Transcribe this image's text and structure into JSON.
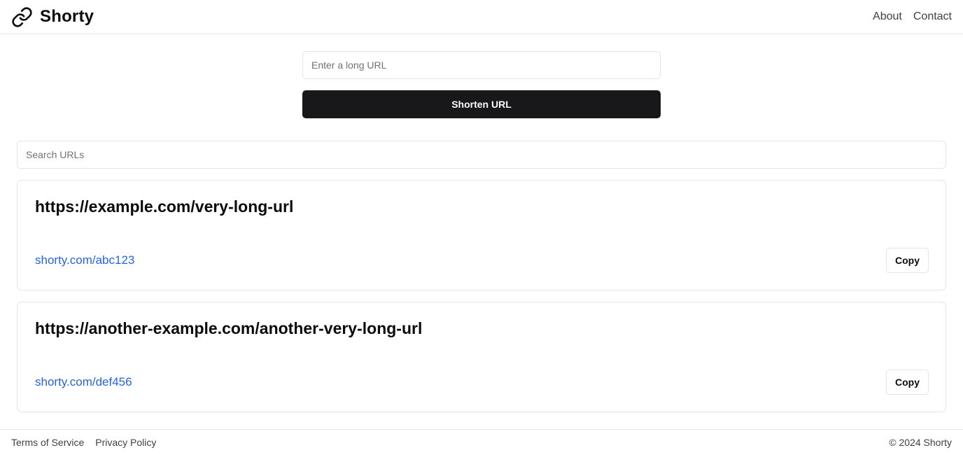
{
  "header": {
    "brand_name": "Shorty",
    "brand_icon": "link-icon",
    "nav": [
      {
        "label": "About"
      },
      {
        "label": "Contact"
      }
    ]
  },
  "shorten_form": {
    "input_placeholder": "Enter a long URL",
    "input_value": "",
    "button_label": "Shorten URL"
  },
  "search": {
    "placeholder": "Search URLs",
    "value": ""
  },
  "urls": [
    {
      "long_url": "https://example.com/very-long-url",
      "short_url": "shorty.com/abc123",
      "copy_label": "Copy"
    },
    {
      "long_url": "https://another-example.com/another-very-long-url",
      "short_url": "shorty.com/def456",
      "copy_label": "Copy"
    }
  ],
  "footer": {
    "links": [
      {
        "label": "Terms of Service"
      },
      {
        "label": "Privacy Policy"
      }
    ],
    "copyright": "© 2024 Shorty"
  },
  "colors": {
    "primary_button": "#18181b",
    "link": "#2563eb",
    "border": "#e4e4e7"
  }
}
